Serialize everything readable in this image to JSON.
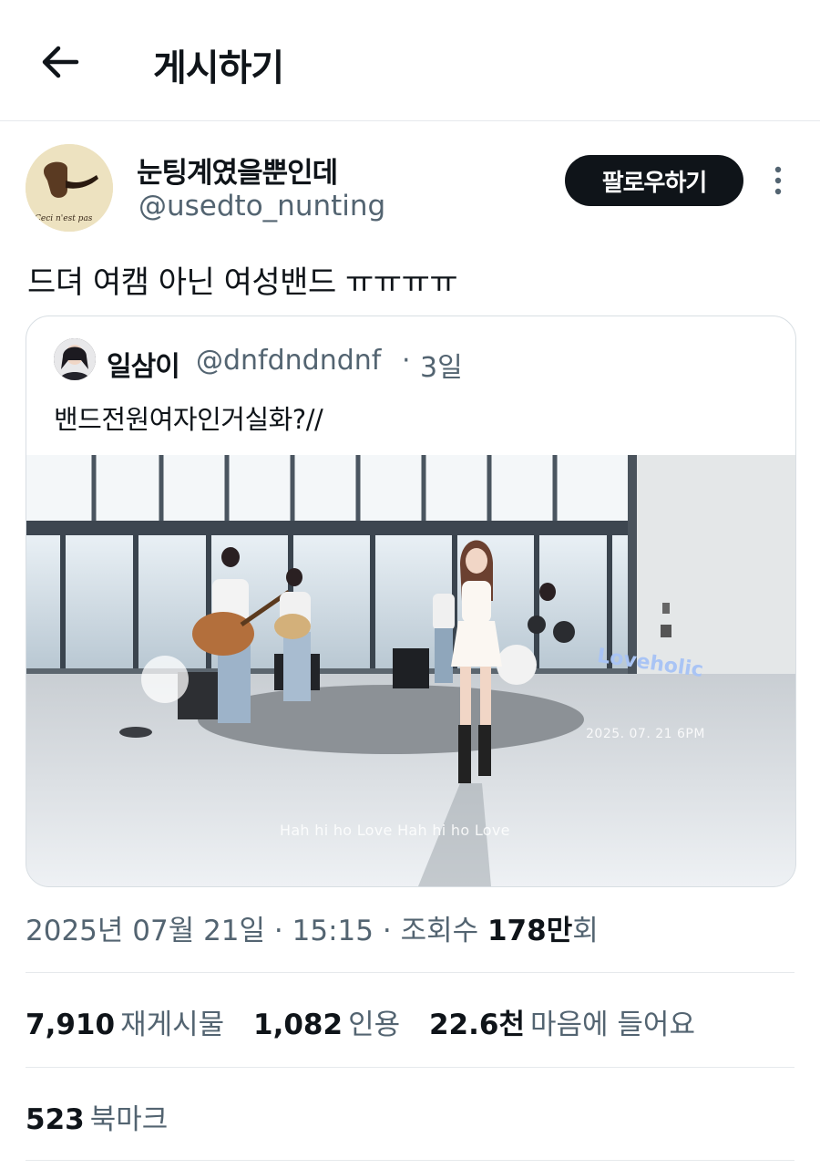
{
  "header": {
    "title": "게시하기"
  },
  "author": {
    "display_name": "눈팅계였을뿐인데",
    "handle": "@usedto_nunting",
    "avatar_caption": "Ceci n'est pas"
  },
  "follow_label": "팔로우하기",
  "tweet_text": "드뎌 여캠 아닌 여성밴드 ㅠㅠㅠㅠ",
  "quote": {
    "display_name": "일삼이",
    "handle": "@dnfdndndnf",
    "separator": "·",
    "time": "3일",
    "text": "밴드전원여자인거실화?//",
    "media": {
      "caption": "Hah hi ho Love Hah hi ho Love",
      "date_overlay": "2025. 07. 21 6PM",
      "brand_overlay": "Loveholic"
    }
  },
  "meta": {
    "date": "2025년 07월 21일",
    "time": "15:15",
    "views_label": "조회수",
    "views_count": "178만",
    "views_suffix": "회"
  },
  "stats": {
    "reposts": {
      "count": "7,910",
      "label": "재게시물"
    },
    "quotes": {
      "count": "1,082",
      "label": "인용"
    },
    "likes": {
      "count": "22.6천",
      "label": "마음에 들어요"
    }
  },
  "bookmarks": {
    "count": "523",
    "label": "북마크"
  },
  "colors": {
    "text": "#0f1419",
    "secondary": "#536471",
    "divider": "#e6e9ec",
    "button_bg": "#0f1419"
  }
}
